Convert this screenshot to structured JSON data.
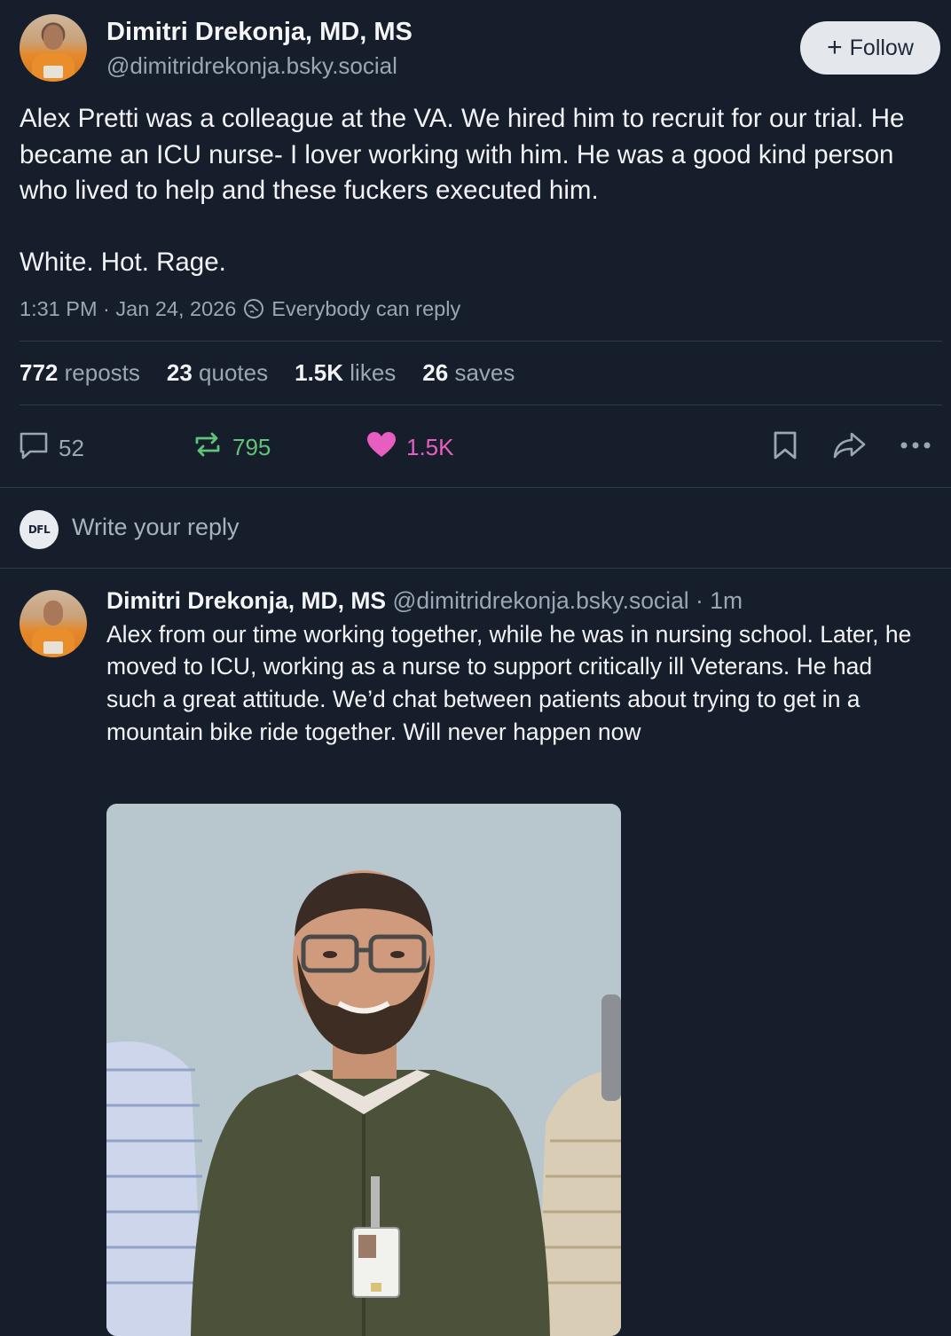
{
  "post": {
    "author_name": "Dimitri Drekonja, MD, MS",
    "author_handle": "@dimitridrekonja.bsky.social",
    "follow_label": "Follow",
    "text": "Alex Pretti was a colleague at the VA. We hired him to recruit for our trial. He became an ICU nurse- I lover working with him. He was a good kind person who lived to help and these fuckers executed him.\n\nWhite. Hot. Rage.",
    "time": "1:31 PM · Jan 24, 2026",
    "reply_setting": "Everybody can reply",
    "stats": {
      "reposts_count": "772",
      "reposts_label": "reposts",
      "quotes_count": "23",
      "quotes_label": "quotes",
      "likes_count": "1.5K",
      "likes_label": "likes",
      "saves_count": "26",
      "saves_label": "saves"
    },
    "actions": {
      "replies": "52",
      "reposts": "795",
      "likes": "1.5K"
    }
  },
  "composer": {
    "avatar_text": "DFL",
    "placeholder": "Write your reply"
  },
  "reply": {
    "author_name": "Dimitri Drekonja, MD, MS",
    "author_handle_time": "@dimitridrekonja.bsky.social · 1m",
    "text": "Alex from our time working together, while he was in nursing school. Later, he moved to ICU, working as a nurse to support critically ill Veterans. He had such a great attitude. We’d chat between patients about trying to get in a mountain bike ride together. Will never happen now"
  },
  "colors": {
    "background": "#161e2b",
    "repost_green": "#5fc37a",
    "like_pink": "#e85ec0",
    "muted": "#9aa6b4"
  },
  "icons": [
    "reply-icon",
    "repost-icon",
    "heart-icon",
    "bookmark-icon",
    "share-icon",
    "more-icon",
    "globe-icon",
    "plus-icon"
  ]
}
